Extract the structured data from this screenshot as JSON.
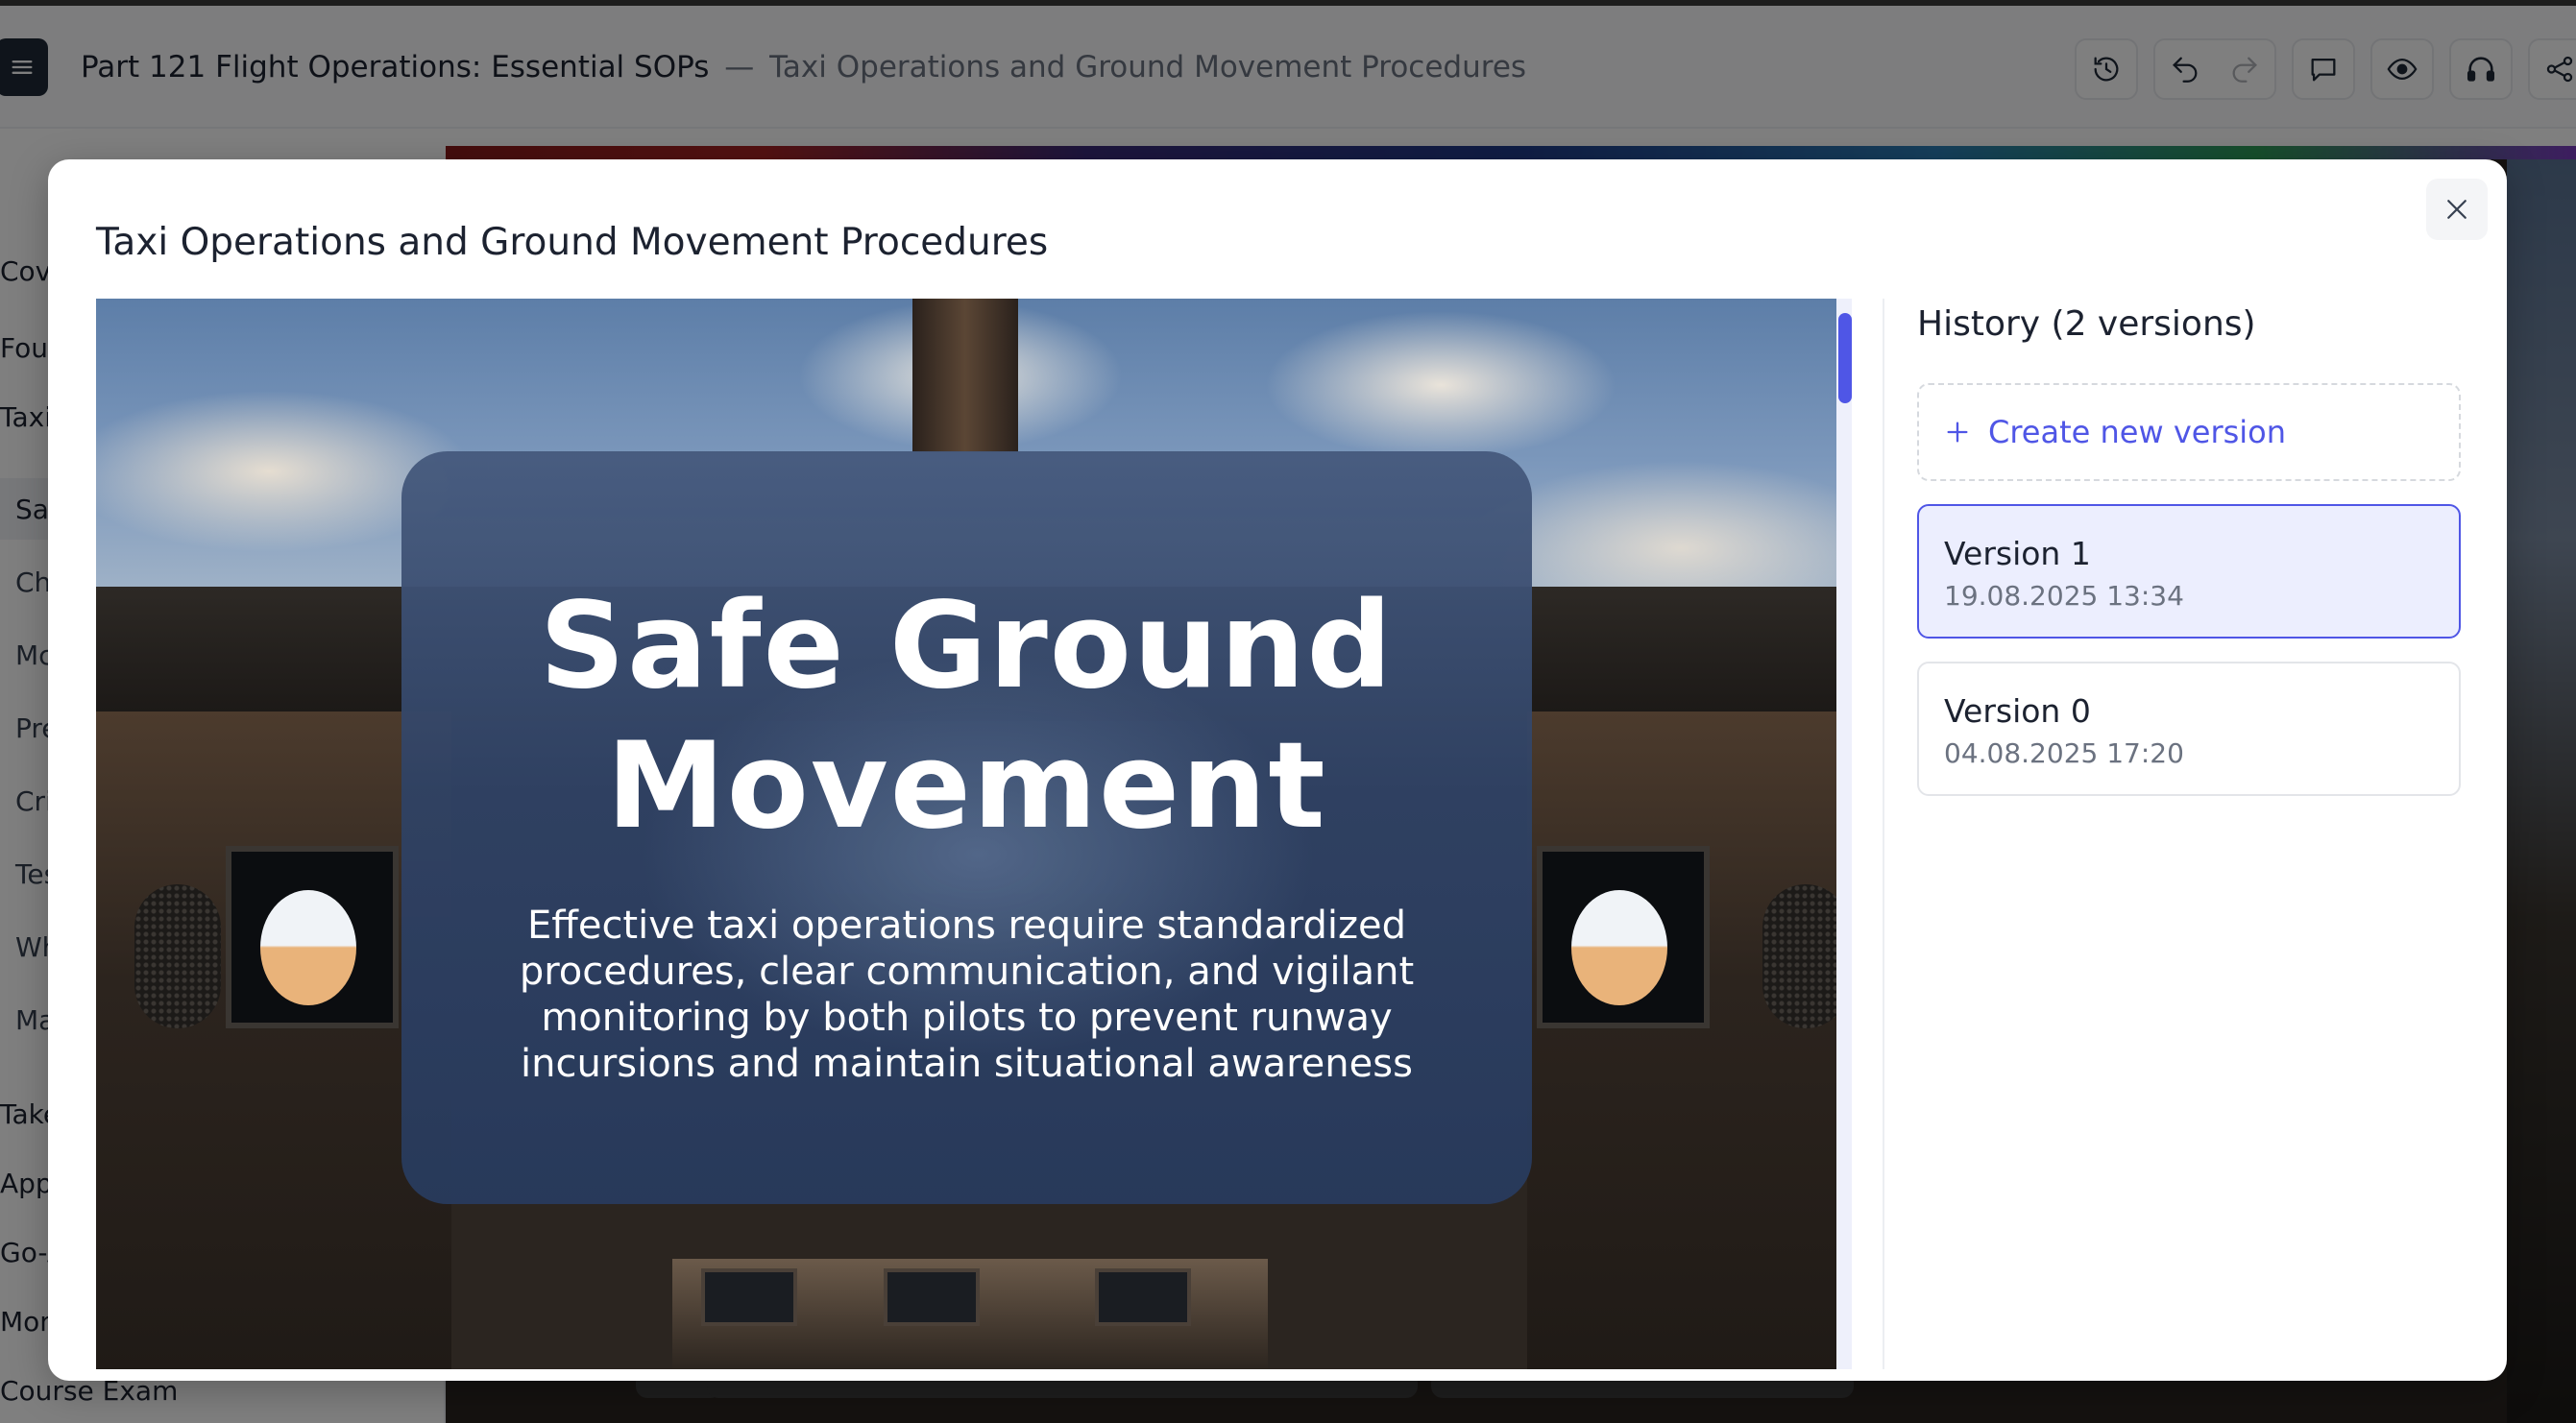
{
  "header": {
    "course_title": "Part 121 Flight Operations: Essential SOPs",
    "separator": "—",
    "lesson_title": "Taxi Operations and Ground Movement Procedures"
  },
  "sidebar": {
    "items": [
      {
        "label": "Cove"
      },
      {
        "label": "Foun"
      },
      {
        "label": "Taxi"
      },
      {
        "label": "Sa"
      },
      {
        "label": "Ch"
      },
      {
        "label": "Mc"
      },
      {
        "label": "Pre"
      },
      {
        "label": "Cri"
      },
      {
        "label": "Tes"
      },
      {
        "label": "Wh"
      },
      {
        "label": "Ma"
      },
      {
        "label": "Take"
      },
      {
        "label": "Appr"
      },
      {
        "label": "Go-A"
      },
      {
        "label": "Moni"
      },
      {
        "label": "Course Exam"
      }
    ]
  },
  "modal": {
    "title": "Taxi Operations and Ground Movement Procedures",
    "slide": {
      "title": "Safe Ground Movement",
      "body": "Effective taxi operations require standardized procedures, clear communication, and vigilant monitoring by both pilots to prevent runway incursions and maintain situational awareness"
    },
    "history": {
      "title": "History (2 versions)",
      "create_label": "Create new version",
      "versions": [
        {
          "name": "Version 1",
          "date": "19.08.2025 13:34",
          "selected": true
        },
        {
          "name": "Version 0",
          "date": "04.08.2025 17:20",
          "selected": false
        }
      ]
    }
  },
  "colors": {
    "accent": "#4f56e6",
    "selected_bg": "#eceefe",
    "slide_card": "#3a5078",
    "overlay": "rgba(0,0,0,0.5)"
  },
  "icons": {
    "toolbar": [
      "history-icon",
      "undo-icon",
      "redo-icon",
      "comment-icon",
      "preview-icon",
      "headphones-icon",
      "share-icon"
    ],
    "menu": "hamburger-icon",
    "close": "close-icon",
    "create": "plus-icon"
  }
}
